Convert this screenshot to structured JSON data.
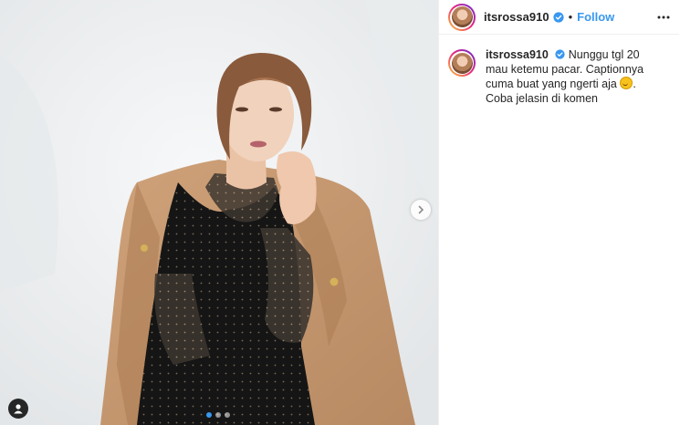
{
  "post": {
    "author": {
      "username": "itsrossa910",
      "verified": true
    },
    "follow_label": "Follow",
    "separator": "•",
    "caption": {
      "username": "itsrossa910",
      "text": "Nunggu tgl 20 mau ketemu pacar. Captionnya cuma buat yang ngerti aja",
      "emoji": "grinning-face-emoji",
      "text_after": ". Coba jelasin di komen"
    },
    "carousel": {
      "slide_count": 3,
      "active_index": 0
    }
  },
  "colors": {
    "link_blue": "#3897f0",
    "verified_blue": "#3897f0",
    "text": "#262626",
    "border": "#efefef"
  },
  "icons": {
    "next": "chevron-right-icon",
    "more": "more-options-icon",
    "tags": "user-tag-icon",
    "verified": "verified-badge-icon"
  }
}
